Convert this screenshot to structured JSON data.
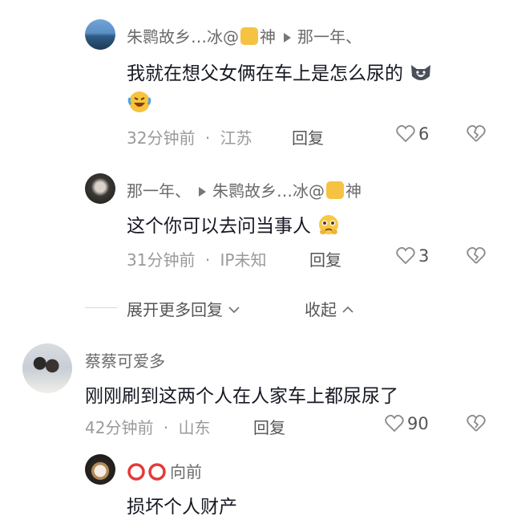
{
  "comments": [
    {
      "user": "朱鹮故乡…冰@",
      "user_suffix": "神",
      "reply_to": "那一年、",
      "text": "我就在想父女俩在车上是怎么尿的",
      "time": "32分钟前",
      "location": "江苏",
      "reply_label": "回复",
      "likes": "6"
    },
    {
      "user": "那一年、",
      "reply_to": "朱鹮故乡…冰@",
      "reply_to_suffix": "神",
      "text": "这个你可以去问当事人",
      "time": "31分钟前",
      "location": "IP未知",
      "reply_label": "回复",
      "likes": "3"
    }
  ],
  "thread_controls": {
    "expand_more": "展开更多回复",
    "collapse": "收起"
  },
  "main_comment": {
    "user": "蔡蔡可爱多",
    "text": "刚刚刷到这两个人在人家车上都尿尿了",
    "time": "42分钟前",
    "location": "山东",
    "reply_label": "回复",
    "likes": "90"
  },
  "sub_comment": {
    "user": "向前",
    "text": "损坏个人财产"
  },
  "separator": "·",
  "colors": {
    "text": "#161823",
    "meta": "#9a9a9a",
    "background": "#ffffff"
  }
}
